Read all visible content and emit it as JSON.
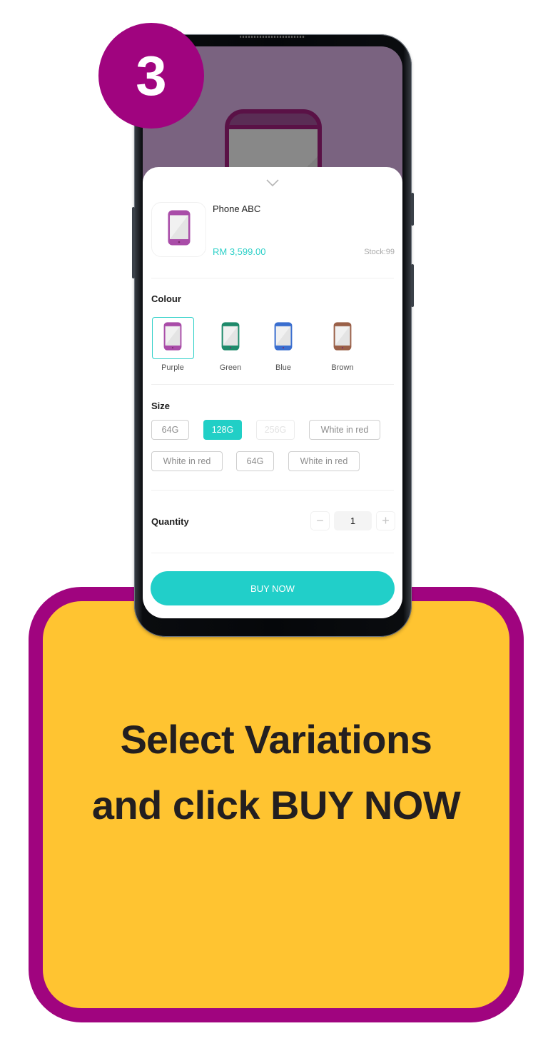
{
  "step": {
    "number": "3",
    "color": "#a0047f"
  },
  "instruction": {
    "strong": "Select",
    "rest_line1": " Variations",
    "line2": "and click BUY NOW",
    "card_color": "#ffc431",
    "border_color": "#a0047f"
  },
  "sheet": {
    "close_icon": "chevron-down-icon",
    "product": {
      "name": "Phone ABC",
      "price": "RM 3,599.00",
      "stock": "Stock:99",
      "image_icon": "phone-icon",
      "price_color": "#2dd0c8"
    },
    "colour": {
      "label": "Colour",
      "options": [
        {
          "label": "Purple",
          "color": "#a94ca8",
          "selected": true
        },
        {
          "label": "Green",
          "color": "#1f8a6b",
          "selected": false
        },
        {
          "label": "Blue",
          "color": "#3a6ecf",
          "selected": false
        },
        {
          "label": "Brown",
          "color": "#9a6048",
          "selected": false
        }
      ]
    },
    "size": {
      "label": "Size",
      "options": [
        {
          "label": "64G",
          "state": "normal"
        },
        {
          "label": "128G",
          "state": "active"
        },
        {
          "label": "256G",
          "state": "disabled"
        },
        {
          "label": "White in red",
          "state": "normal"
        },
        {
          "label": "White in red",
          "state": "normal"
        },
        {
          "label": "64G",
          "state": "normal"
        },
        {
          "label": "White in red",
          "state": "normal"
        }
      ]
    },
    "quantity": {
      "label": "Quantity",
      "value": "1",
      "minus": "−",
      "plus": "+"
    },
    "buy_button": "BUY NOW",
    "accent": "#21cfc9"
  }
}
